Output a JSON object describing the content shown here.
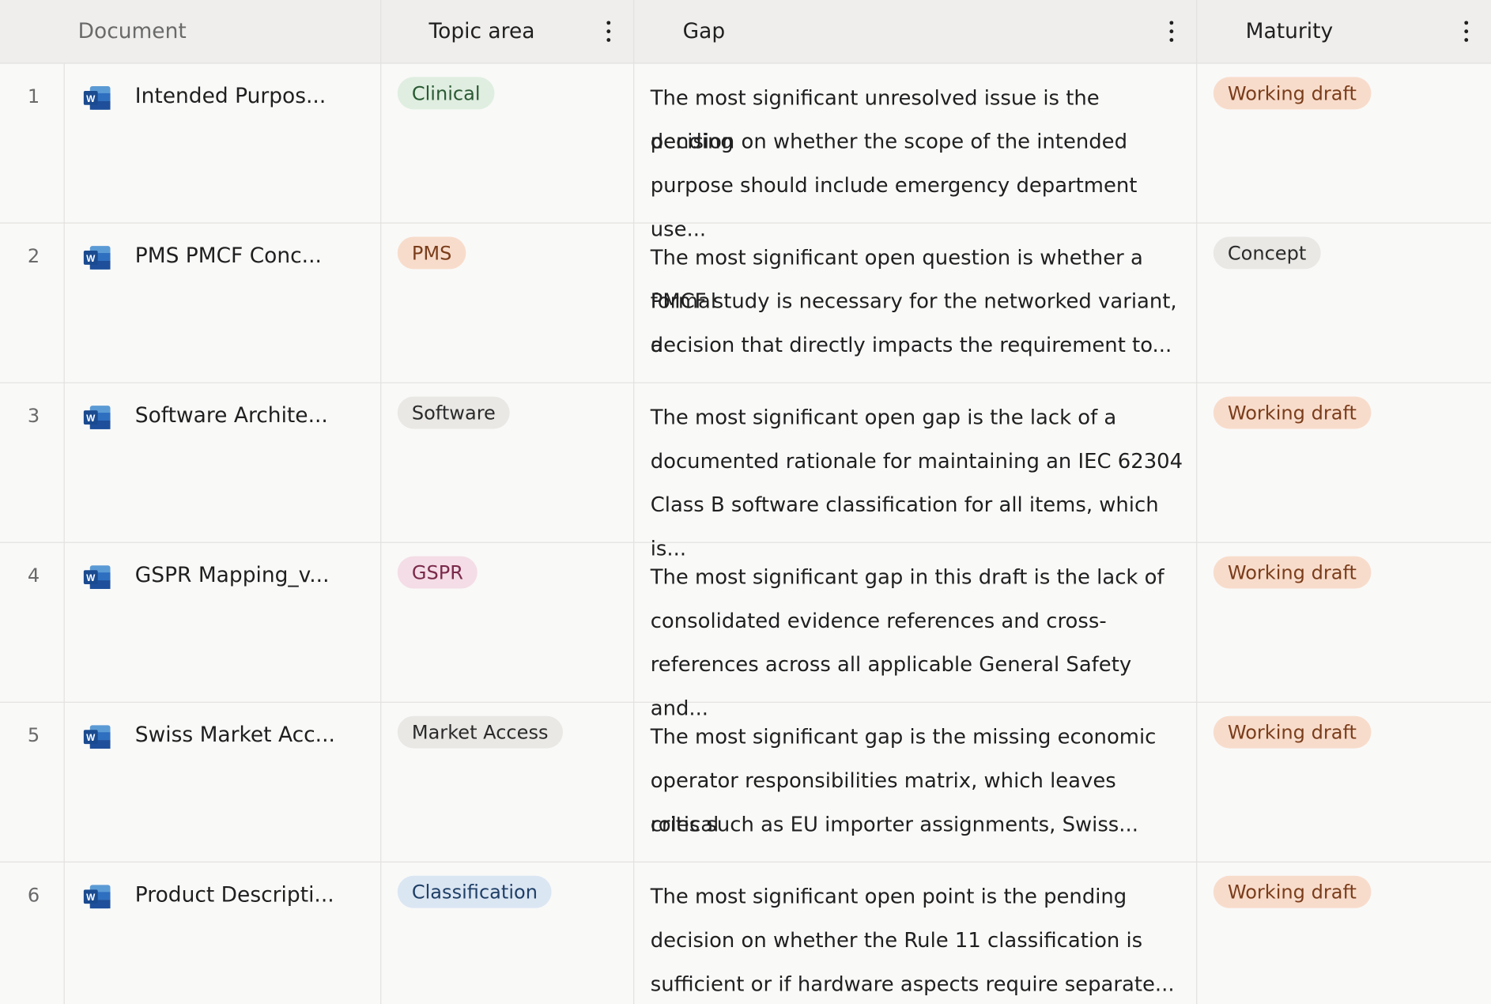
{
  "columns": {
    "document": "Document",
    "topic_area": "Topic area",
    "gap": "Gap",
    "maturity": "Maturity"
  },
  "colors": {
    "clinical_bg": "#dfeee0",
    "clinical_fg": "#2a5a33",
    "pms_bg": "#f8dccb",
    "pms_fg": "#7a3d1b",
    "software_bg": "#e9e8e5",
    "software_fg": "#2a2a2a",
    "gspr_bg": "#f4dde6",
    "gspr_fg": "#7a2a4a",
    "market_bg": "#e9e8e5",
    "market_fg": "#2a2a2a",
    "classification_bg": "#dbe6f3",
    "classification_fg": "#1f3f66",
    "working_bg": "#f8dccb",
    "working_fg": "#7a3d1b",
    "concept_bg": "#e9e8e5",
    "concept_fg": "#2a2a2a"
  },
  "rows": [
    {
      "num": "1",
      "document": "Intended Purpos...",
      "topic": "Clinical",
      "gap_lines": [
        "The most significant unresolved issue is the pending",
        "decision on whether the scope of the intended",
        "purpose should include emergency department use..."
      ],
      "maturity": "Working draft"
    },
    {
      "num": "2",
      "document": "PMS PMCF Conc...",
      "topic": "PMS",
      "gap_lines": [
        "The most significant open question is whether a formal",
        "PMCF study is necessary for the networked variant, a",
        "decision that directly impacts the requirement to..."
      ],
      "maturity": "Concept"
    },
    {
      "num": "3",
      "document": "Software Archite...",
      "topic": "Software",
      "gap_lines": [
        "The most significant open gap is the lack of a",
        "documented rationale for maintaining an IEC 62304",
        "Class B software classification for all items, which is..."
      ],
      "maturity": "Working draft"
    },
    {
      "num": "4",
      "document": "GSPR Mapping_v...",
      "topic": "GSPR",
      "gap_lines": [
        "The most significant gap in this draft is the lack of",
        "consolidated evidence references and cross-",
        "references across all applicable General Safety and..."
      ],
      "maturity": "Working draft"
    },
    {
      "num": "5",
      "document": "Swiss Market Acc...",
      "topic": "Market Access",
      "gap_lines": [
        "The most significant gap is the missing economic",
        "operator responsibilities matrix, which leaves critical",
        "roles such as EU importer assignments, Swiss..."
      ],
      "maturity": "Working draft"
    },
    {
      "num": "6",
      "document": "Product Descripti...",
      "topic": "Classification",
      "gap_lines": [
        "The most significant open point is the pending",
        "decision on whether the Rule 11 classification is",
        "sufficient or if hardware aspects require separate..."
      ],
      "maturity": "Working draft"
    }
  ],
  "icons": {
    "document": "word-doc-icon",
    "column_menu": "kebab-menu-icon"
  }
}
